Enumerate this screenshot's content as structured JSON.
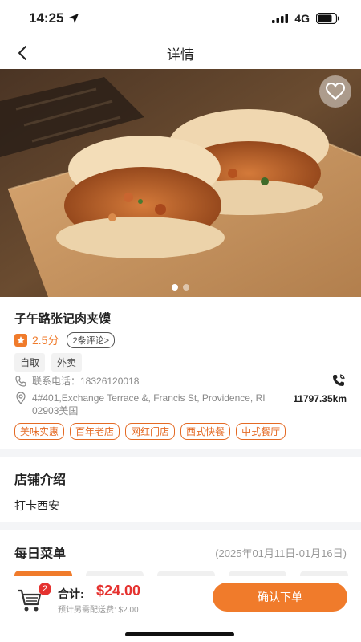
{
  "status_bar": {
    "time": "14:25",
    "network": "4G"
  },
  "nav": {
    "title": "详情"
  },
  "hero": {
    "slide_count": 2,
    "active_slide": 1
  },
  "shop": {
    "name": "子午路张记肉夹馍",
    "rating": "2.5分",
    "reviews": "2条评论>",
    "services": [
      "自取",
      "外卖"
    ],
    "phone": "联系电话：18326120018",
    "address": "4#401,Exchange Terrace &, Francis St, Providence, RI 02903美国",
    "distance": "11797.35km",
    "tags": [
      "美味实惠",
      "百年老店",
      "网红门店",
      "西式快餐",
      "中式餐厅"
    ]
  },
  "intro": {
    "title": "店铺介绍",
    "text": "打卡西安"
  },
  "menu": {
    "title": "每日菜单",
    "date_range": "(2025年01月11日-01月16日)",
    "day_tab_count": 5
  },
  "footer": {
    "cart_count": "2",
    "total_label": "合计:",
    "total_amount": "$24.00",
    "delivery_note": "预计另需配送费: $2.00",
    "order_button": "确认下单"
  },
  "colors": {
    "accent": "#f07b2b",
    "price": "#e5322f"
  }
}
